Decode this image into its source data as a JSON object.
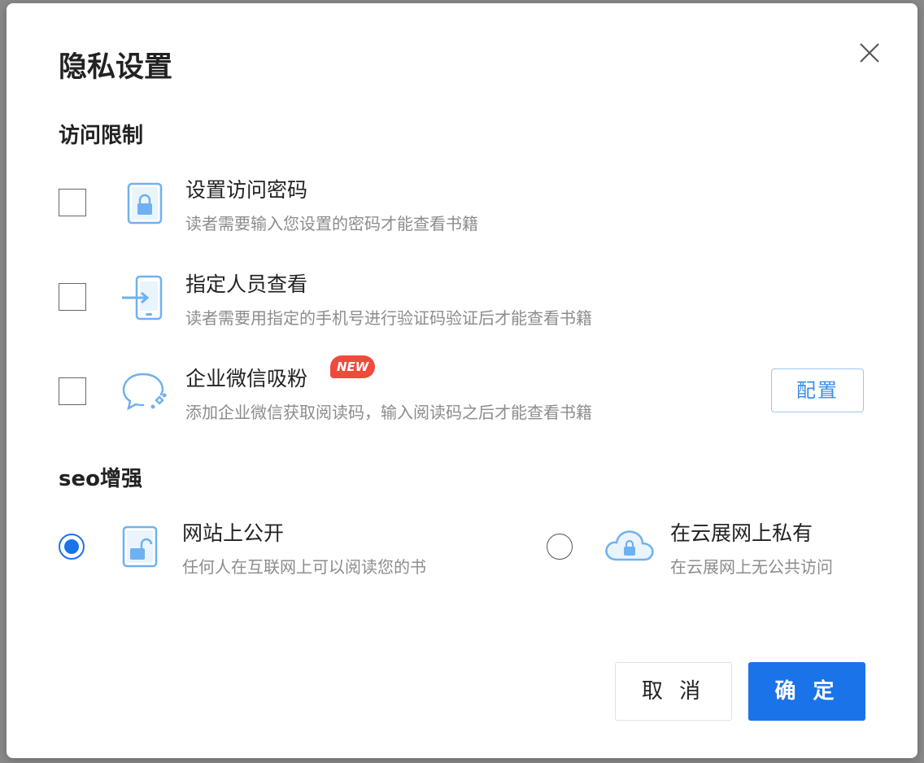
{
  "dialog": {
    "title": "隐私设置",
    "close_icon": "close-icon"
  },
  "access": {
    "section_title": "访问限制",
    "items": [
      {
        "title": "设置访问密码",
        "desc": "读者需要输入您设置的密码才能查看书籍",
        "icon": "lock-book-icon",
        "checked": false
      },
      {
        "title": "指定人员查看",
        "desc": "读者需要用指定的手机号进行验证码验证后才能查看书籍",
        "icon": "phone-login-icon",
        "checked": false
      },
      {
        "title": "企业微信吸粉",
        "desc": "添加企业微信获取阅读码，输入阅读码之后才能查看书籍",
        "icon": "wechat-work-icon",
        "checked": false,
        "badge": "NEW",
        "action_label": "配置"
      }
    ]
  },
  "seo": {
    "section_title": "seo增强",
    "options": [
      {
        "title": "网站上公开",
        "desc": "任何人在互联网上可以阅读您的书",
        "icon": "unlocked-book-icon",
        "selected": true
      },
      {
        "title": "在云展网上私有",
        "desc": "在云展网上无公共访问",
        "icon": "cloud-lock-icon",
        "selected": false
      }
    ]
  },
  "footer": {
    "cancel_label": "取 消",
    "ok_label": "确 定"
  },
  "colors": {
    "primary": "#1a73e8",
    "icon_blue": "#6fb1f0",
    "badge_red": "#f04a3c",
    "muted_text": "#8c8c8c"
  }
}
